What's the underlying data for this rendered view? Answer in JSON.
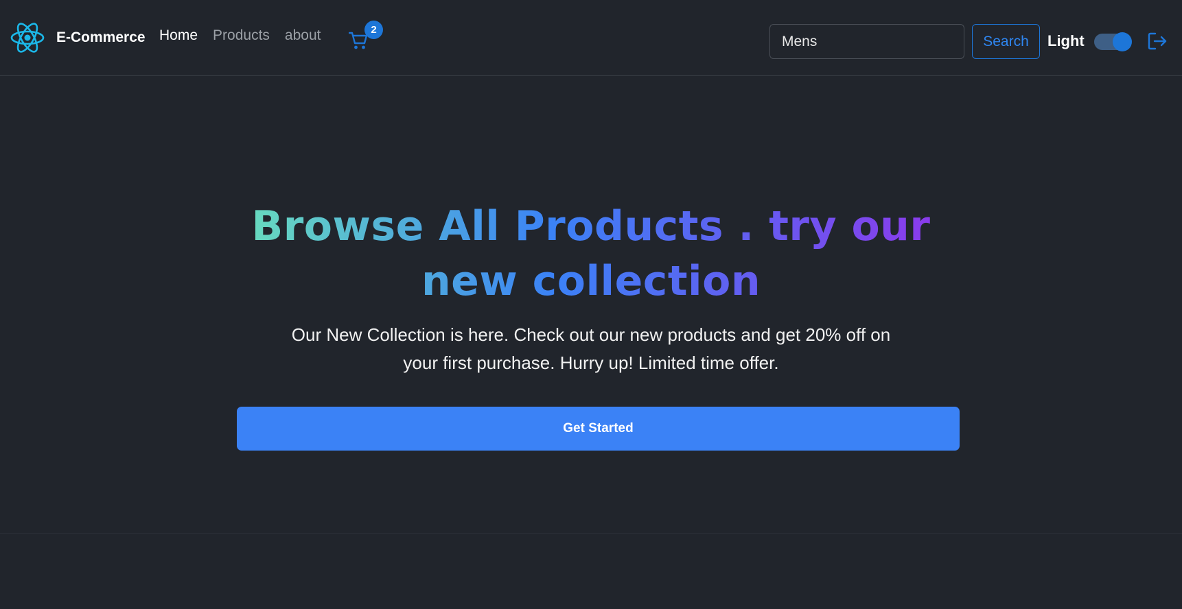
{
  "navbar": {
    "brand": "E-Commerce",
    "links": [
      {
        "label": "Home",
        "active": true
      },
      {
        "label": "Products",
        "active": false
      },
      {
        "label": "about",
        "active": false
      }
    ],
    "cart_count": "2",
    "search": {
      "value": "Mens",
      "button_label": "Search"
    },
    "theme_label": "Light",
    "theme_toggle_on": true
  },
  "hero": {
    "title": "Browse All Products . try our new collection",
    "description": "Our New Collection is here. Check out our new products and get 20% off on your first purchase. Hurry up! Limited time offer.",
    "button_label": "Get Started"
  },
  "colors": {
    "background": "#21252c",
    "accent": "#3b82f6",
    "link_blue": "#1d76d8",
    "gradient_start": "#6ee7b7",
    "gradient_end": "#9333ea"
  },
  "icons": {
    "logo": "react-atom-icon",
    "cart": "shopping-cart-icon",
    "logout": "logout-icon"
  }
}
